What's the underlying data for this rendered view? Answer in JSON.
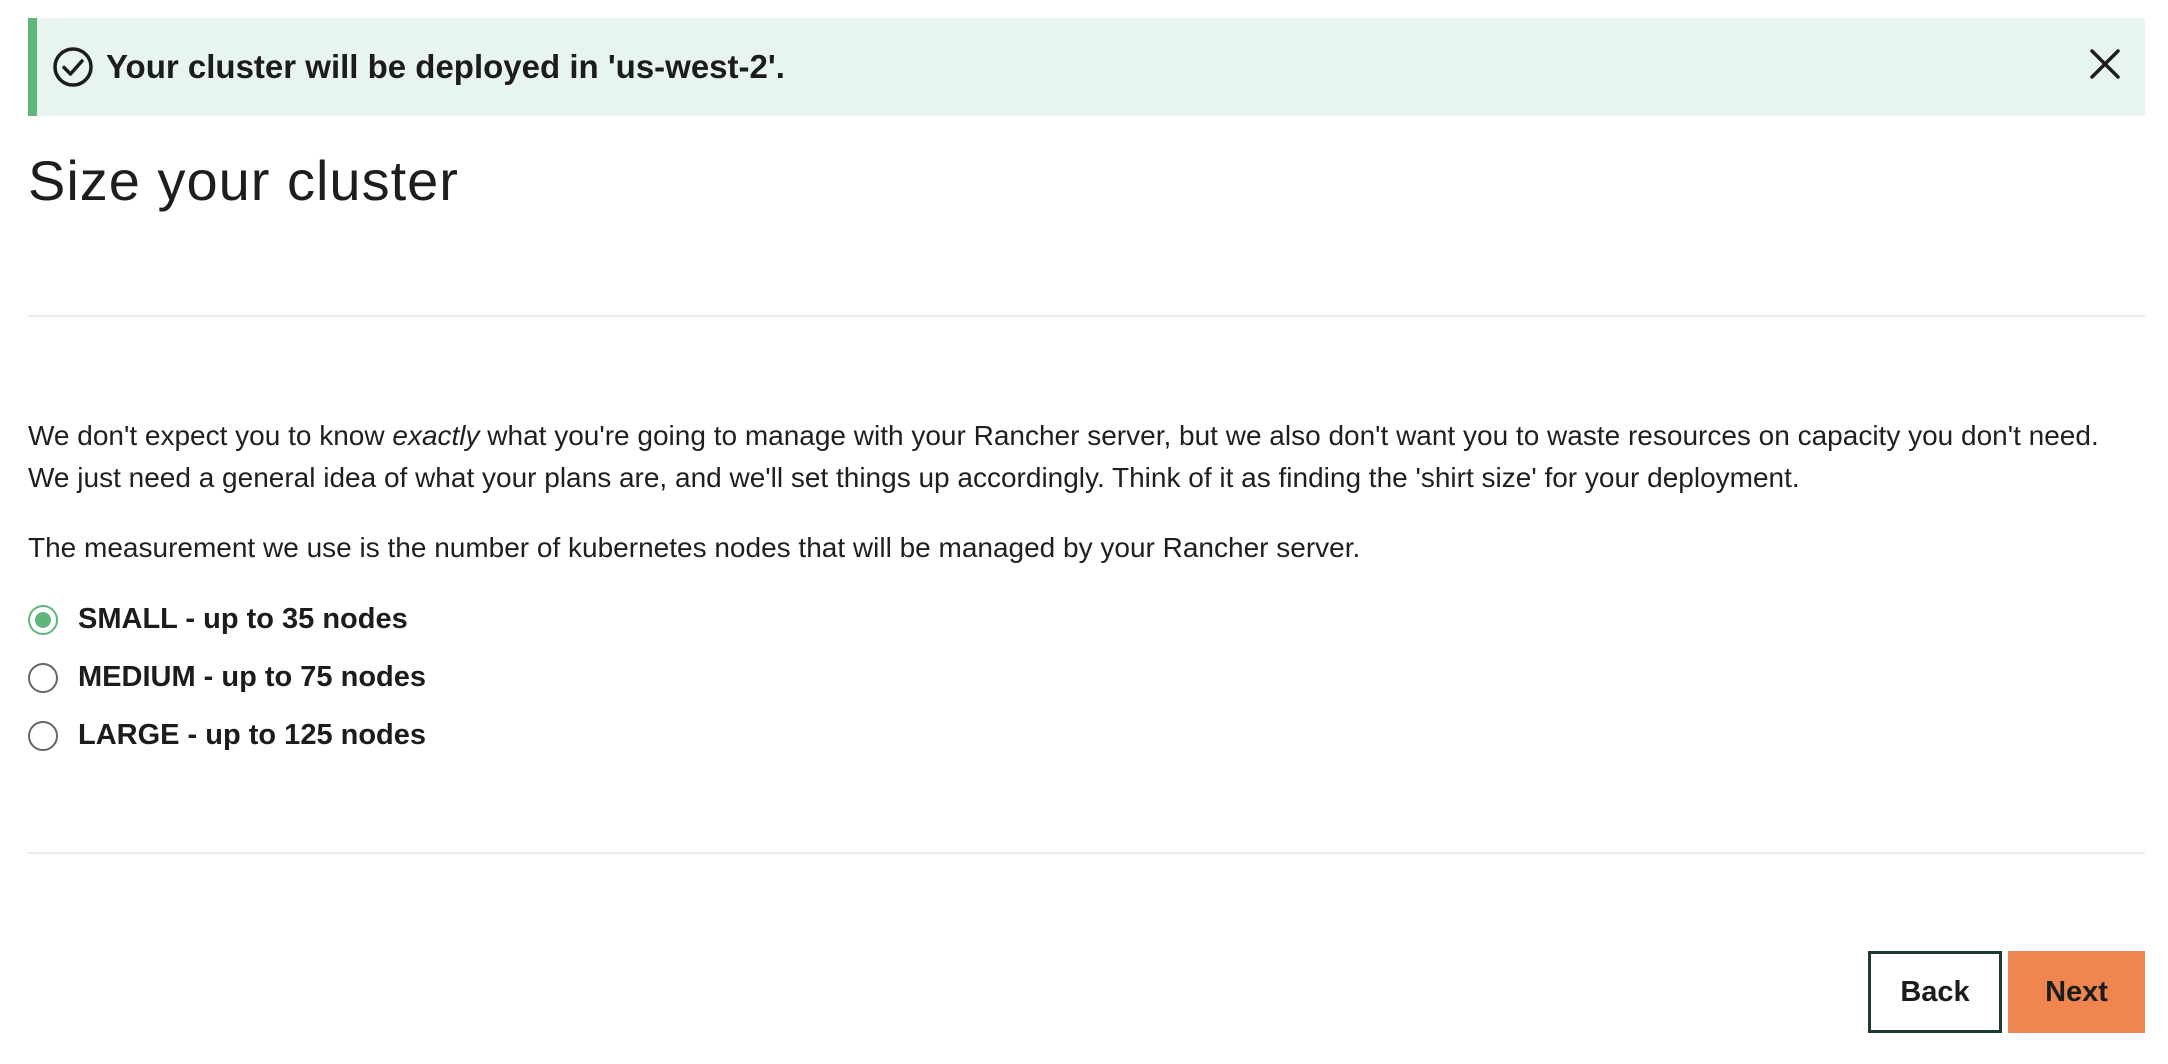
{
  "banner": {
    "icon": "check-circle-icon",
    "message": "Your cluster will be deployed in 'us-west-2'.",
    "close_icon": "close-icon",
    "accent_color": "#5fb57a",
    "background_color": "#e8f5ee"
  },
  "page": {
    "title": "Size your cluster"
  },
  "intro": {
    "before_em": "We don't expect you to know ",
    "em": "exactly",
    "after_em": " what you're going to manage with your Rancher server, but we also don't want you to waste resources on capacity you don't need. We just need a general idea of what your plans are, and we'll set things up accordingly. Think of it as finding the 'shirt size' for your deployment.",
    "measurement": "The measurement we use is the number of kubernetes nodes that will be managed by your Rancher server."
  },
  "size_options": [
    {
      "label": "SMALL - up to 35 nodes",
      "selected": true
    },
    {
      "label": "MEDIUM - up to 75 nodes",
      "selected": false
    },
    {
      "label": "LARGE - up to 125 nodes",
      "selected": false
    }
  ],
  "actions": {
    "back_label": "Back",
    "next_label": "Next",
    "next_color": "#ef864f"
  }
}
